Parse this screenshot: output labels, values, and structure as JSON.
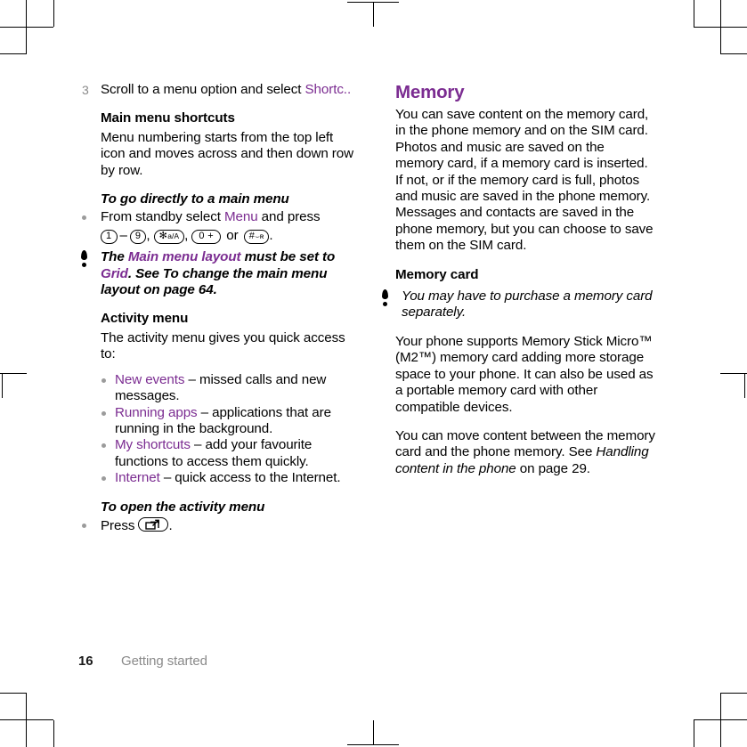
{
  "document": {
    "page_number": "16",
    "chapter": "Getting started",
    "accent_color": "#7B2C91"
  },
  "left_column": {
    "step": {
      "number": "3",
      "text_before": "Scroll to a menu option and select ",
      "highlight": "Shortc.",
      "text_after": "."
    },
    "main_menu_shortcuts": {
      "heading": "Main menu shortcuts",
      "body": "Menu numbering starts from the top left icon and moves across and then down row by row."
    },
    "to_go_directly": {
      "heading": "To go directly to a main menu",
      "bullet_prefix": "From standby select ",
      "bullet_highlight": "Menu",
      "bullet_mid": " and press",
      "keys": {
        "key_1": "1",
        "dash": "–",
        "key_9": "9",
        "sep1": ",",
        "key_star_main": "✻",
        "key_star_sub": "a/A",
        "sep2": ",",
        "key_zero": "0 +",
        "or": "or",
        "key_hash_main": "#",
        "key_hash_sub": "⌣ʀ",
        "end": "."
      }
    },
    "note": {
      "text_1": "The ",
      "highlight_1": "Main menu layout",
      "text_2": " must be set to ",
      "highlight_2": "Grid",
      "text_3": ". See To change the main menu layout on page 64."
    },
    "activity_menu": {
      "heading": "Activity menu",
      "intro": "The activity menu gives you quick access to:",
      "items": [
        {
          "label": "New events",
          "desc": " – missed calls and new messages."
        },
        {
          "label": "Running apps",
          "desc": " – applications that are running in the background."
        },
        {
          "label": "My shortcuts",
          "desc": " – add your favourite functions to access them quickly."
        },
        {
          "label": "Internet",
          "desc": " – quick access to the Internet."
        }
      ]
    },
    "to_open_activity": {
      "heading": "To open the activity menu",
      "bullet_prefix": "Press ",
      "key_icon": "activity-menu-key-icon",
      "bullet_suffix": "."
    }
  },
  "right_column": {
    "memory": {
      "heading": "Memory",
      "paragraph": "You can save content on the memory card, in the phone memory and on the SIM card. Photos and music are saved on the memory card, if a memory card is inserted. If not, or if the memory card is full, photos and music are saved in the phone memory. Messages and contacts are saved in the phone memory, but you can choose to save them on the SIM card."
    },
    "memory_card": {
      "heading": "Memory card",
      "note": "You may have to purchase a memory card separately.",
      "paragraph_1": "Your phone supports Memory Stick Micro™ (M2™) memory card adding more storage space to your phone. It can also be used as a portable memory card with other compatible devices.",
      "paragraph_2_before": "You can move content between the memory card and the phone memory. See ",
      "paragraph_2_italic": "Handling content in the phone",
      "paragraph_2_after": " on page 29."
    }
  }
}
